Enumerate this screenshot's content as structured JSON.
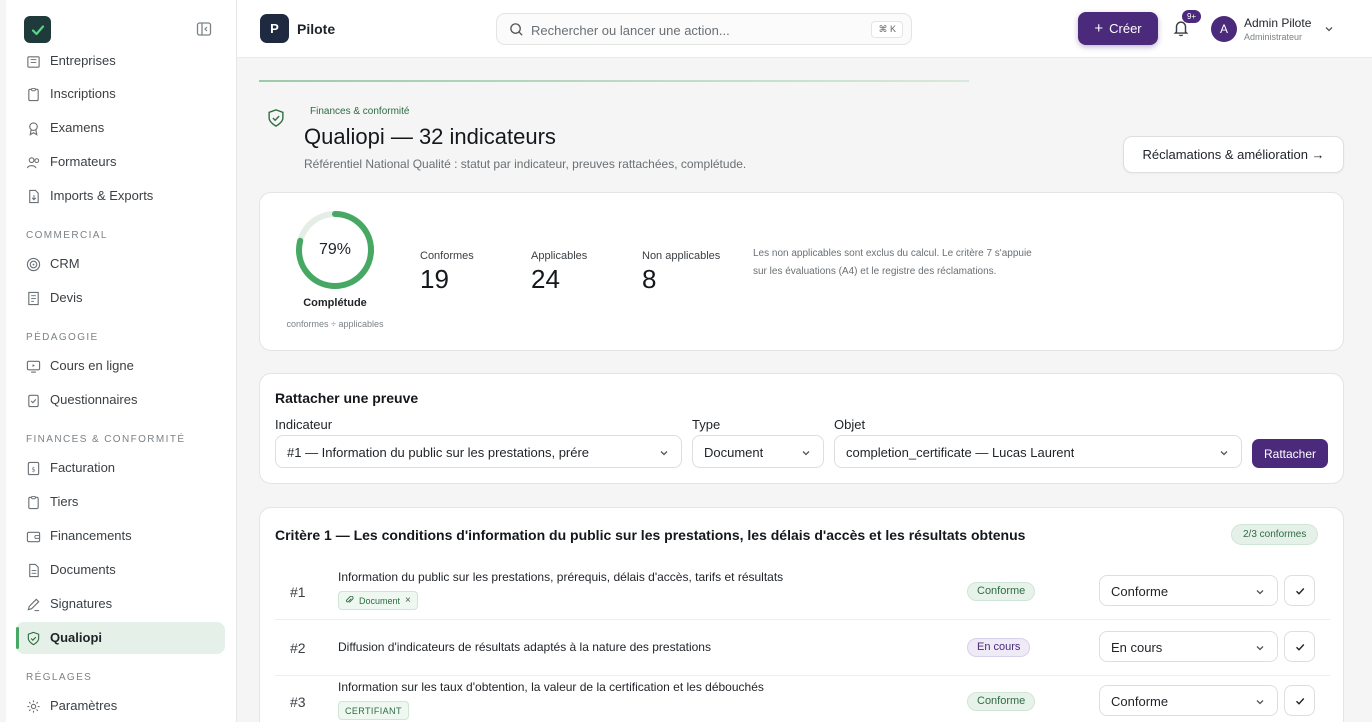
{
  "sidebar": {
    "items": [
      {
        "label": "Entreprises",
        "icon": "building-icon"
      },
      {
        "label": "Inscriptions",
        "icon": "clipboard-icon"
      },
      {
        "label": "Examens",
        "icon": "award-icon"
      },
      {
        "label": "Formateurs",
        "icon": "users-icon"
      },
      {
        "label": "Imports & Exports",
        "icon": "file-arrow-icon"
      }
    ],
    "commercial": {
      "title": "COMMERCIAL",
      "items": [
        {
          "label": "CRM",
          "icon": "target-icon"
        },
        {
          "label": "Devis",
          "icon": "receipt-icon"
        }
      ]
    },
    "pedagogie": {
      "title": "PÉDAGOGIE",
      "items": [
        {
          "label": "Cours en ligne",
          "icon": "monitor-icon"
        },
        {
          "label": "Questionnaires",
          "icon": "clipboard-check-icon"
        }
      ]
    },
    "finances": {
      "title": "FINANCES & CONFORMITÉ",
      "items": [
        {
          "label": "Facturation",
          "icon": "invoice-icon"
        },
        {
          "label": "Tiers",
          "icon": "clipboard-icon"
        },
        {
          "label": "Financements",
          "icon": "wallet-icon"
        },
        {
          "label": "Documents",
          "icon": "document-icon"
        },
        {
          "label": "Signatures",
          "icon": "pen-icon"
        },
        {
          "label": "Qualiopi",
          "icon": "shield-check-icon"
        }
      ]
    },
    "reglages": {
      "title": "RÉGLAGES",
      "items": [
        {
          "label": "Paramètres",
          "icon": "gear-icon"
        }
      ]
    }
  },
  "topbar": {
    "app_initial": "P",
    "app_name": "Pilote",
    "search_placeholder": "Rechercher ou lancer une action...",
    "shortcut": "⌘ K",
    "create_label": "Créer",
    "notif_count": "9+",
    "user_initial": "A",
    "user_name": "Admin Pilote",
    "user_role": "Administrateur"
  },
  "header": {
    "eyebrow": "Finances & conformité",
    "title": "Qualiopi — 32 indicateurs",
    "subtitle": "Référentiel National Qualité : statut par indicateur, preuves rattachées, complétude.",
    "action_label": "Réclamations & amélioration →"
  },
  "stats": {
    "completion_pct": 79,
    "completion_text": "79%",
    "completion_label": "Complétude",
    "completion_note": "conformes ÷ applicables",
    "conformes_label": "Conformes",
    "conformes_value": "19",
    "applicables_label": "Applicables",
    "applicables_value": "24",
    "na_label": "Non applicables",
    "na_value": "8",
    "note": "Les non applicables sont exclus du calcul. Le critère 7 s'appuie sur les évaluations (A4) et le registre des réclamations."
  },
  "attach": {
    "title": "Rattacher une preuve",
    "indicator_label": "Indicateur",
    "indicator_value": "#1 — Information du public sur les prestations, prére",
    "type_label": "Type",
    "type_value": "Document",
    "object_label": "Objet",
    "object_value": "completion_certificate — Lucas Laurent",
    "button_label": "Rattacher"
  },
  "criterion": {
    "title": "Critère 1 — Les conditions d'information du public sur les prestations, les délais d'accès et les résultats obtenus",
    "badge": "2/3 conformes",
    "rows": [
      {
        "num": "#1",
        "text": "Information du public sur les prestations, prérequis, délais d'accès, tarifs et résultats",
        "tag": "Document",
        "tag_remove": "×",
        "status": "Conforme",
        "select": "Conforme"
      },
      {
        "num": "#2",
        "text": "Diffusion d'indicateurs de résultats adaptés à la nature des prestations",
        "status": "En cours",
        "select": "En cours"
      },
      {
        "num": "#3",
        "text": "Information sur les taux d'obtention, la valeur de la certification et les débouchés",
        "tag": "CERTIFIANT",
        "status": "Conforme",
        "select": "Conforme"
      }
    ]
  },
  "colors": {
    "accent": "#4b2a7b",
    "success": "#46a862",
    "sidebar_active": "#e5f1e8"
  }
}
